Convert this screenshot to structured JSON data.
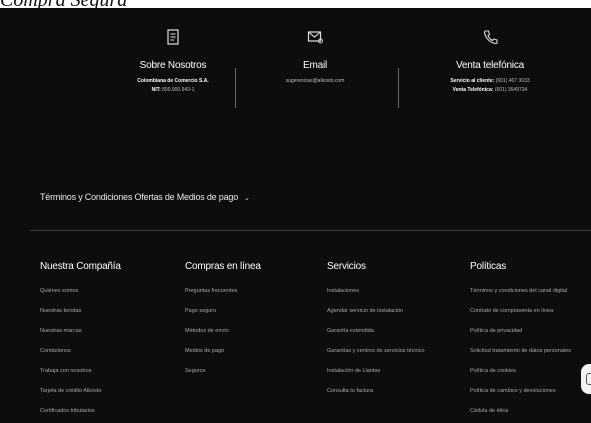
{
  "page_heading": "Compra Segura",
  "contact": [
    {
      "icon": "document-icon",
      "title": "Sobre Nosotros",
      "lines": [
        {
          "label": "Colombiana de Comercio S.A.",
          "value": ""
        },
        {
          "label": "NIT:",
          "value": "890.900.943-1"
        }
      ]
    },
    {
      "icon": "mail-icon",
      "title": "Email",
      "lines": [
        {
          "label": "",
          "value": "sugerencias@alkosto.com"
        }
      ]
    },
    {
      "icon": "phone-icon",
      "title": "Venta telefónica",
      "lines": [
        {
          "label": "Servicio al cliente:",
          "value": "(601) 407 3033"
        },
        {
          "label": "Venta Telefónica:",
          "value": "(601) 3649734"
        }
      ]
    }
  ],
  "terms": {
    "label": "Términos y Condiciones Ofertas de Medios de pago",
    "chevron": "⌄"
  },
  "columns": [
    {
      "title": "Nuestra Compañía",
      "links": [
        "Quiénes somos",
        "Nuestras tiendas",
        "Nuestras marcas",
        "Contáctenos",
        "Trabaja con nosotros",
        "Tarjeta de crédito Alkosto",
        "Certificados tributarios"
      ]
    },
    {
      "title": "Compras en línea",
      "links": [
        "Preguntas frecuentes",
        "Pago seguro",
        "Métodos de envío",
        "Medios de pago",
        "Seguros"
      ]
    },
    {
      "title": "Servicios",
      "links": [
        "Instalaciones",
        "Agendar servicio de instalación",
        "Garantía extendida",
        "Garantías y centros de servicios técnico",
        "Instalación de Llantas",
        "Consulta tu factura"
      ]
    },
    {
      "title": "Políticas",
      "links": [
        "Términos y condiciones del canal digital",
        "Contrato de compraventa en línea",
        "Política de privacidad",
        "Solicitud tratamiento de datos personales",
        "Política de cookies",
        "Política de cambios y devoluciones",
        "Cédula de ética"
      ]
    }
  ],
  "colors": {
    "footer_bg": "#0d0d0d",
    "text": "#ffffff",
    "muted": "#a8a8a8"
  }
}
